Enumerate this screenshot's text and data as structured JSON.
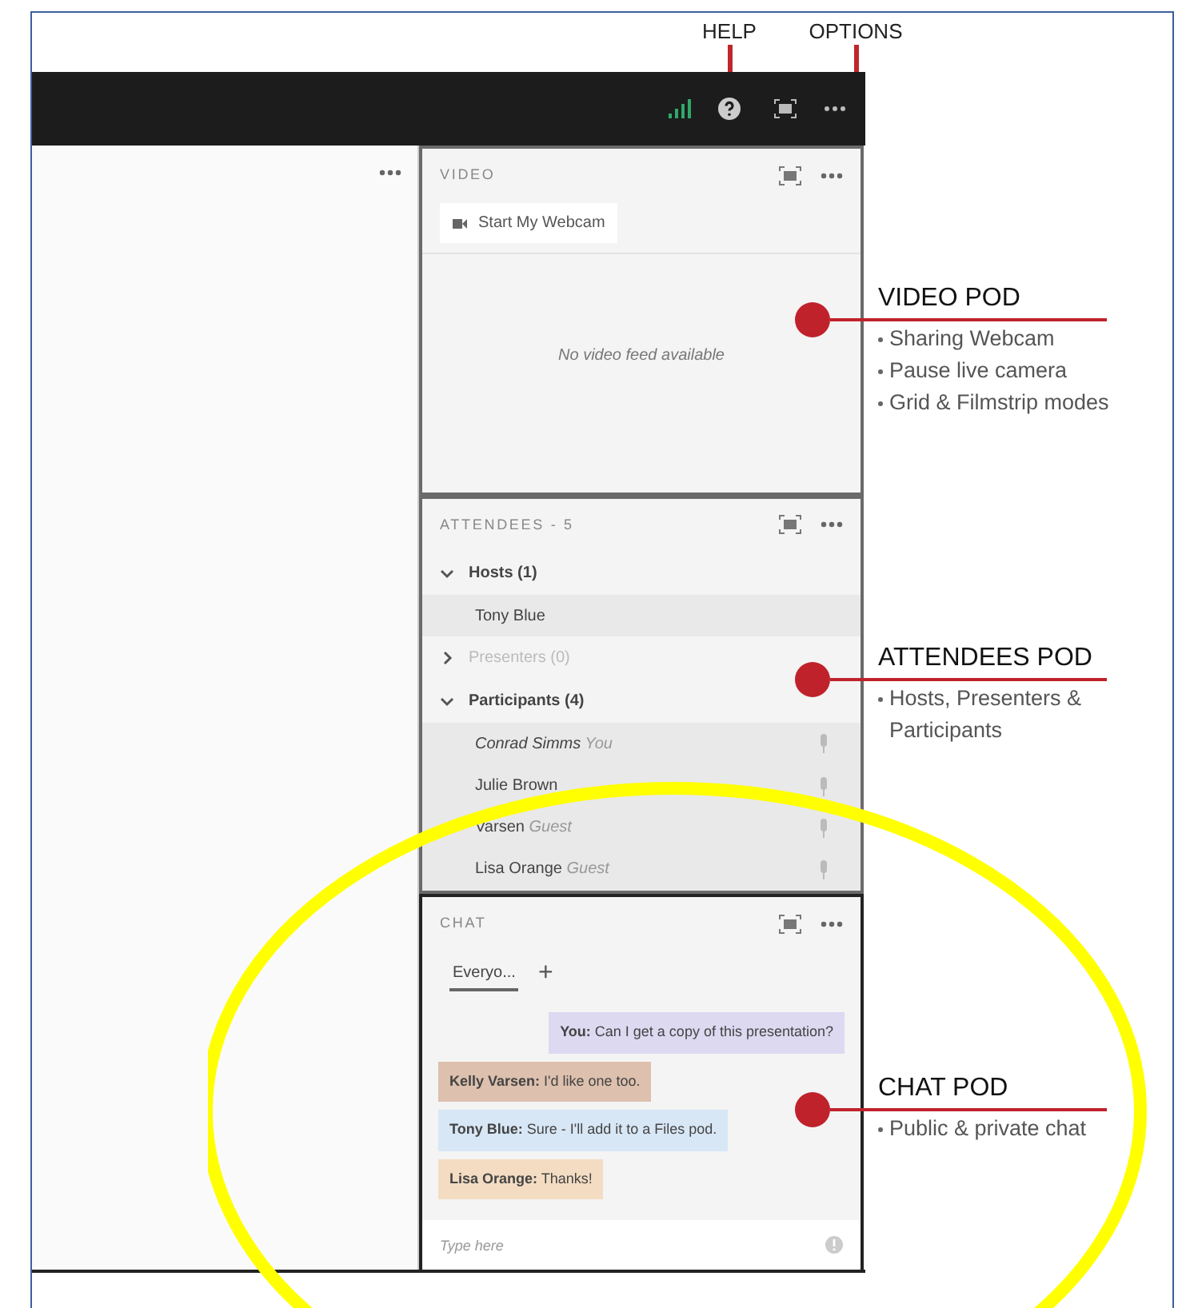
{
  "top_annotations": [
    {
      "label": "HELP"
    },
    {
      "label": "OPTIONS"
    }
  ],
  "video_pod": {
    "title": "VIDEO",
    "webcam_button": "Start My Webcam",
    "empty_message": "No video feed available"
  },
  "attendees_pod": {
    "title": "ATTENDEES - 5",
    "groups": [
      {
        "label": "Hosts (1)",
        "expanded": true,
        "disabled": false,
        "children": [
          {
            "name": "Tony Blue",
            "self": false
          }
        ]
      },
      {
        "label": "Presenters (0)",
        "expanded": false,
        "disabled": true
      },
      {
        "label": "Participants (4)",
        "expanded": true,
        "disabled": false,
        "children": [
          {
            "name": "Conrad Simms",
            "role": "You",
            "self": true
          },
          {
            "name": "Julie Brown",
            "self": false
          },
          {
            "name": "Varsen",
            "role": "Guest",
            "self": false
          },
          {
            "name": "Lisa Orange",
            "role": "Guest",
            "self": false
          }
        ]
      }
    ]
  },
  "chat_pod": {
    "title": "CHAT",
    "tabs": [
      {
        "label": "Everyo...",
        "selected": true
      }
    ],
    "add_tab": "+",
    "messages": [
      {
        "sender": "You:",
        "text": "Can I get a copy of this presentation?",
        "mine": true,
        "color": "#dcd9f1"
      },
      {
        "sender": "Kelly Varsen:",
        "text": "I'd like one too.",
        "mine": false,
        "color": "#ddc0ae"
      },
      {
        "sender": "Tony Blue:",
        "text": "Sure - I'll add it to a Files pod.",
        "mine": false,
        "color": "#d8e7f6"
      },
      {
        "sender": "Lisa Orange:",
        "text": "Thanks!",
        "mine": false,
        "color": "#f3dcc2"
      }
    ],
    "input": {
      "placeholder": "Type here"
    }
  },
  "callouts": [
    {
      "title": "VIDEO POD",
      "bullets": [
        "Sharing Webcam",
        "Pause live camera",
        "Grid & Filmstrip modes"
      ]
    },
    {
      "title": "ATTENDEES POD",
      "bullets": [
        "Hosts, Presenters & Participants"
      ]
    },
    {
      "title": "CHAT POD",
      "bullets": [
        "Public & private chat"
      ]
    }
  ]
}
